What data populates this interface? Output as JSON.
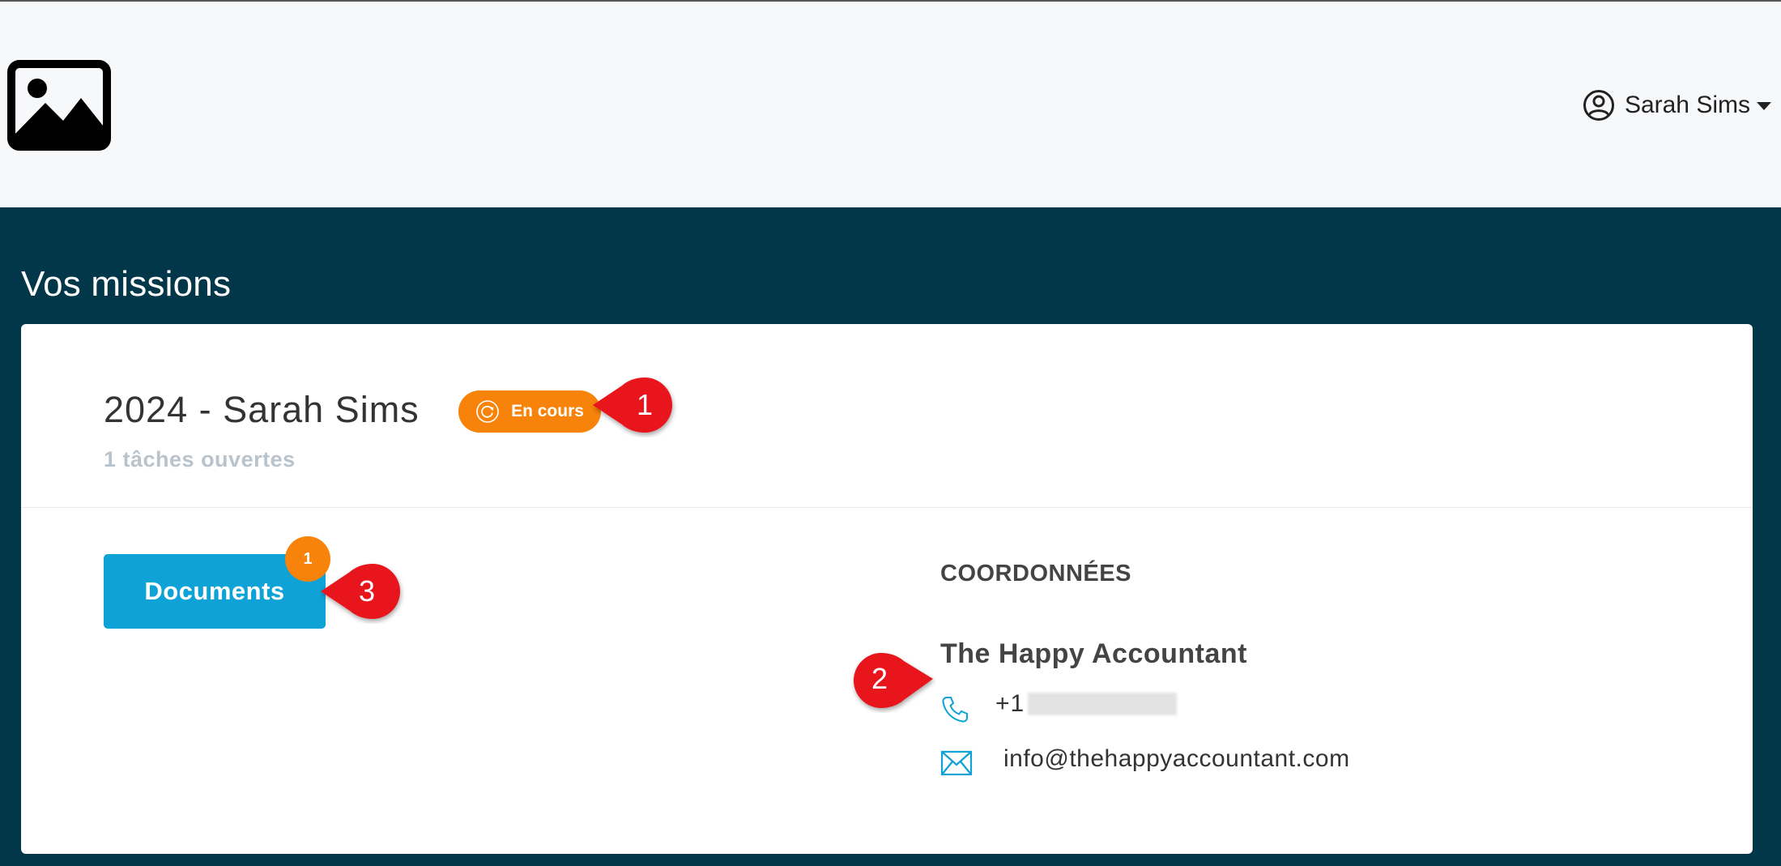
{
  "header": {
    "user_name": "Sarah Sims"
  },
  "page": {
    "title": "Vos missions"
  },
  "mission": {
    "title": "2024 - Sarah Sims",
    "status": "En cours",
    "open_tasks": "1 tâches ouvertes"
  },
  "documents": {
    "label": "Documents",
    "count": "1"
  },
  "contact": {
    "heading": "COORDONNÉES",
    "company": "The Happy Accountant",
    "phone_prefix": "+1",
    "email": "info@thehappyaccountant.com"
  },
  "callouts": [
    "1",
    "2",
    "3"
  ],
  "colors": {
    "header_bg": "#f7f8fa",
    "page_bg": "#02374a",
    "status_orange": "#f7830a",
    "button_blue": "#0ea2d6",
    "callout_red": "#e8141b"
  },
  "icons": {
    "logo": "image-placeholder-icon",
    "user": "user-circle-icon",
    "status": "refresh-icon",
    "phone": "phone-icon",
    "email": "envelope-icon"
  }
}
